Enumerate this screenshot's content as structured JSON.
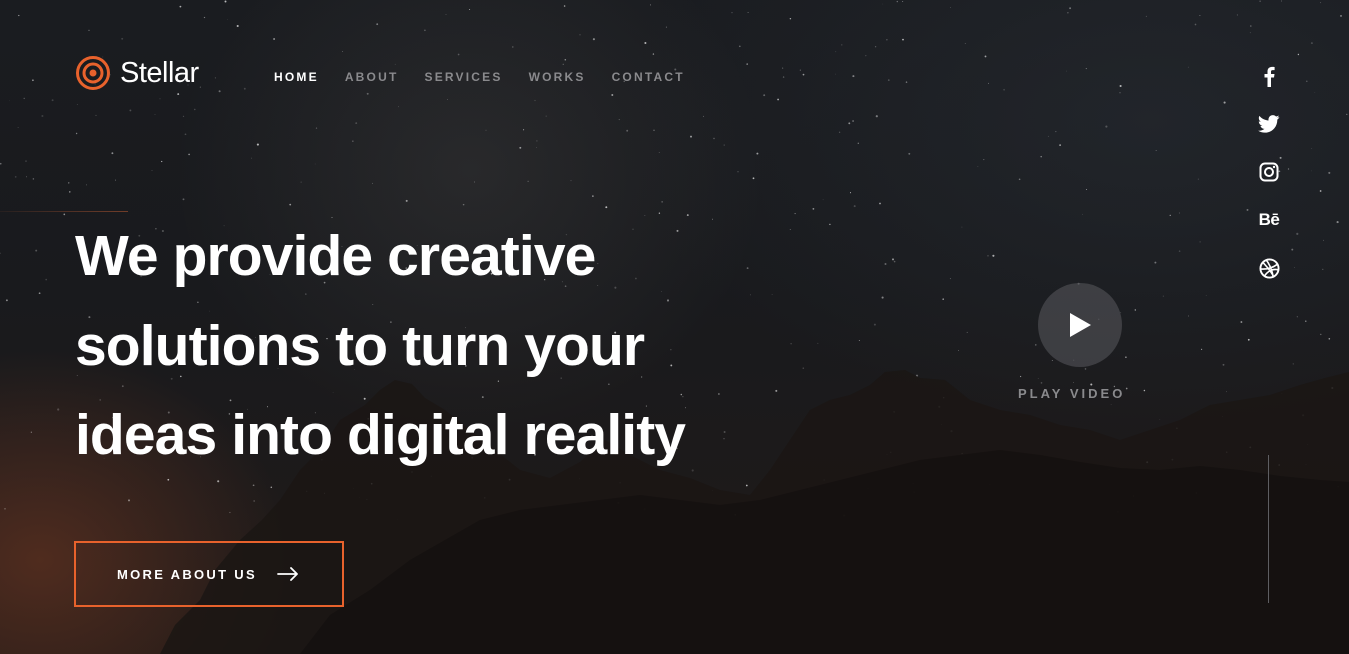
{
  "brand": {
    "name": "Stellar",
    "accent_color": "#e8622c",
    "logo_icon": "target-rings-icon"
  },
  "nav": {
    "items": [
      {
        "label": "HOME",
        "active": true
      },
      {
        "label": "ABOUT",
        "active": false
      },
      {
        "label": "SERVICES",
        "active": false
      },
      {
        "label": "WORKS",
        "active": false
      },
      {
        "label": "CONTACT",
        "active": false
      }
    ]
  },
  "hero": {
    "headline_lines": [
      "We provide creative",
      "solutions to turn your",
      "ideas into digital reality"
    ],
    "cta_label": "MORE ABOUT US",
    "cta_icon": "arrow-right-icon",
    "play_label": "PLAY VIDEO",
    "play_icon": "play-icon"
  },
  "social": {
    "icons": [
      "facebook-icon",
      "twitter-icon",
      "instagram-icon",
      "behance-icon",
      "dribbble-icon"
    ],
    "behance_text": "Bē"
  }
}
